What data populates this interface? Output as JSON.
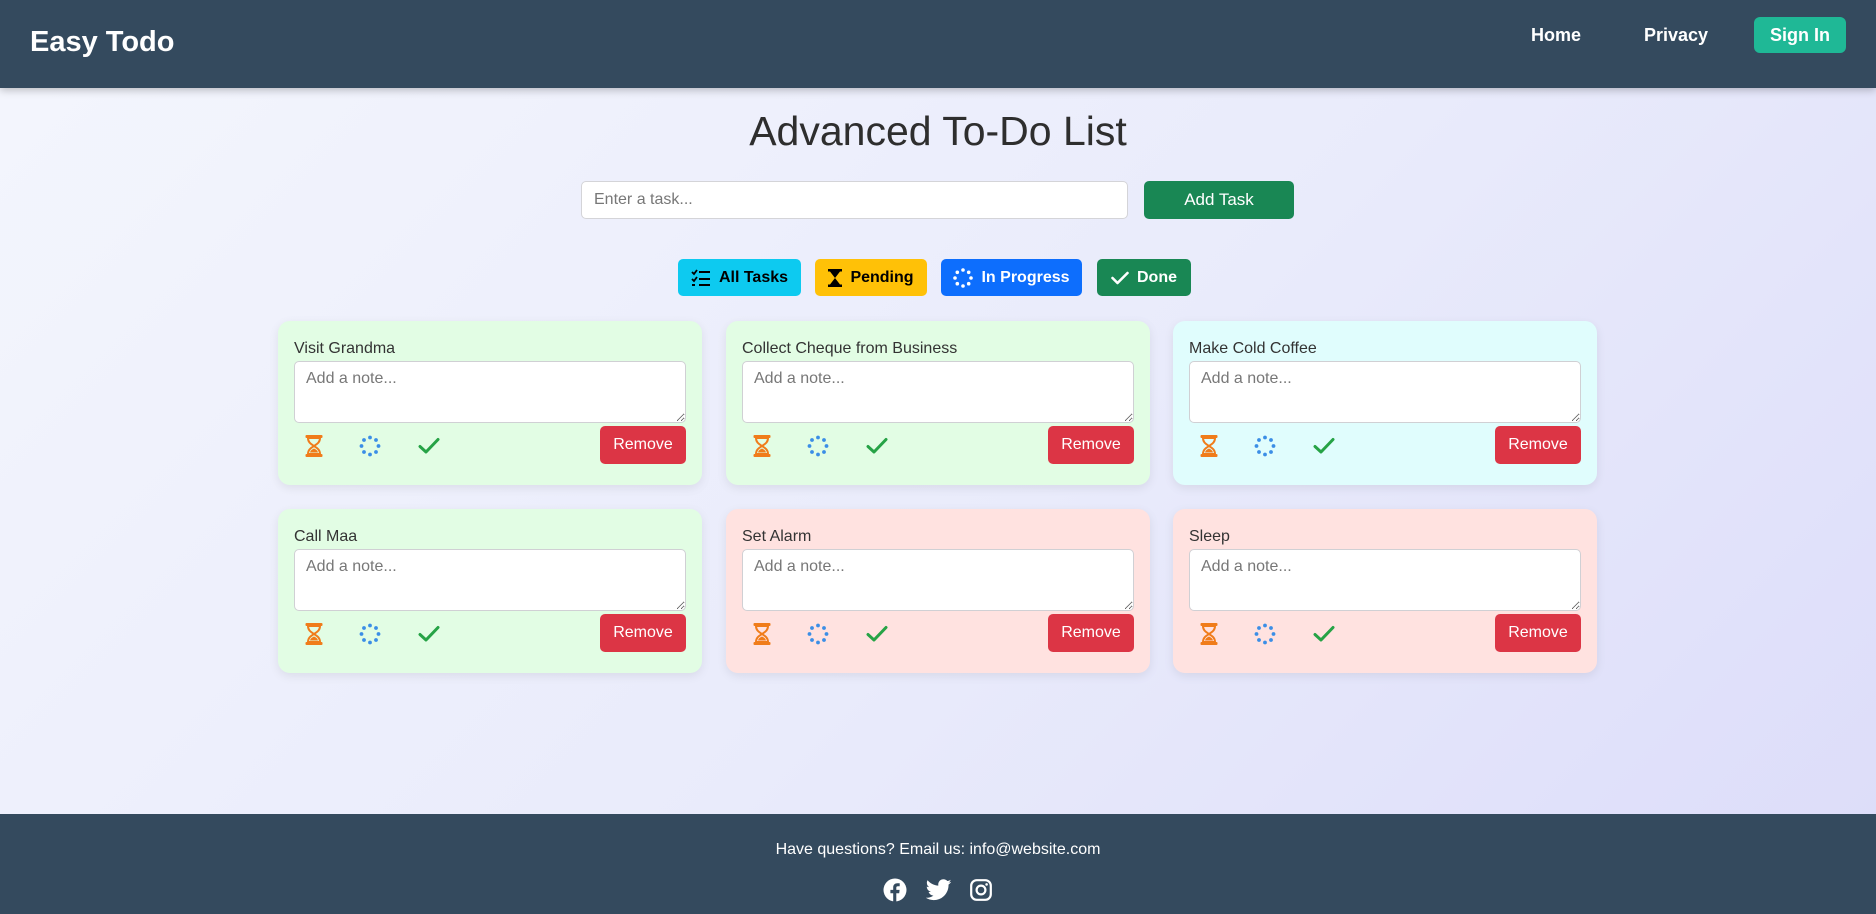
{
  "header": {
    "brand": "Easy Todo",
    "nav": {
      "home": "Home",
      "privacy": "Privacy",
      "sign_in": "Sign In"
    }
  },
  "main": {
    "title": "Advanced To-Do List",
    "task_input": {
      "placeholder": "Enter a task...",
      "value": ""
    },
    "add_button": "Add Task",
    "filters": {
      "all": {
        "label": "All Tasks",
        "icon": "checklist-icon"
      },
      "pending": {
        "label": "Pending",
        "icon": "hourglass-icon"
      },
      "in_progress": {
        "label": "In Progress",
        "icon": "spinner-icon"
      },
      "done": {
        "label": "Done",
        "icon": "check-icon"
      }
    },
    "tasks": [
      {
        "title": "Visit Grandma",
        "note_placeholder": "Add a note...",
        "color": "#e2fde4",
        "remove": "Remove"
      },
      {
        "title": "Collect Cheque from Business",
        "note_placeholder": "Add a note...",
        "color": "#e2fde4",
        "remove": "Remove"
      },
      {
        "title": "Make Cold Coffee",
        "note_placeholder": "Add a note...",
        "color": "#e0fdfd",
        "remove": "Remove"
      },
      {
        "title": "Call Maa",
        "note_placeholder": "Add a note...",
        "color": "#e2fde4",
        "remove": "Remove"
      },
      {
        "title": "Set Alarm",
        "note_placeholder": "Add a note...",
        "color": "#ffe2e0",
        "remove": "Remove"
      },
      {
        "title": "Sleep",
        "note_placeholder": "Add a note...",
        "color": "#ffe2e0",
        "remove": "Remove"
      }
    ],
    "status_icons": {
      "pending": "hourglass-icon",
      "in_progress": "spinner-icon",
      "done": "check-icon"
    }
  },
  "footer": {
    "text": "Have questions? Email us: info@website.com",
    "social": [
      "facebook-icon",
      "twitter-icon",
      "instagram-icon"
    ]
  },
  "colors": {
    "header_bg": "#344a5e",
    "sign_in": "#1fb896",
    "add_task": "#198754",
    "filter_all": "#0dcaf0",
    "filter_pending": "#ffc107",
    "filter_in_progress": "#0d6efd",
    "filter_done": "#198754",
    "remove": "#dc3545",
    "pending_icon": "#f07c1a",
    "progress_icon": "#3b8ee6",
    "done_icon": "#26a346"
  }
}
